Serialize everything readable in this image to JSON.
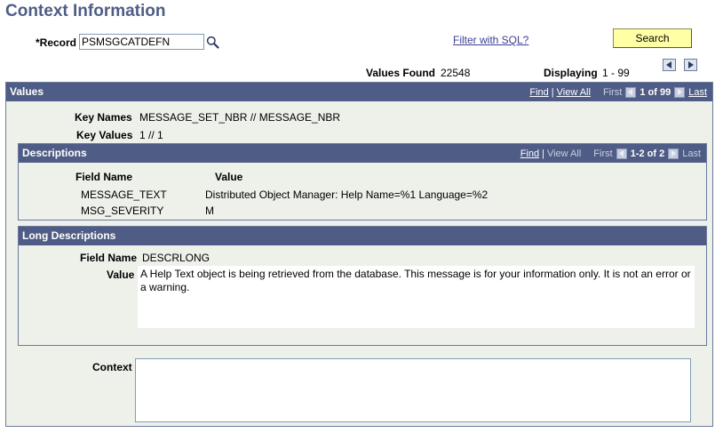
{
  "page": {
    "title": "Context Information"
  },
  "record": {
    "label": "*Record",
    "value": "PSMSGCATDEFN",
    "lookup_icon": "magnifier-icon"
  },
  "toolbar": {
    "filter_link": "Filter with SQL?",
    "search_label": "Search"
  },
  "results": {
    "values_found_label": "Values Found",
    "values_found": "22548",
    "displaying_label": "Displaying",
    "displaying_range": "1 - 99",
    "prev_icon": "triangle-left-icon",
    "next_icon": "triangle-right-icon"
  },
  "values_panel": {
    "title": "Values",
    "nav": {
      "find": "Find",
      "view_all": "View All",
      "first": "First",
      "counter": "1 of 99",
      "last": "Last"
    },
    "key_names_label": "Key Names",
    "key_names": "MESSAGE_SET_NBR // MESSAGE_NBR",
    "key_values_label": "Key Values",
    "key_values": "1 // 1"
  },
  "descriptions_panel": {
    "title": "Descriptions",
    "nav": {
      "find": "Find",
      "view_all": "View All",
      "first": "First",
      "counter": "1-2 of 2",
      "last": "Last"
    },
    "columns": [
      "Field Name",
      "Value"
    ],
    "rows": [
      {
        "field": "MESSAGE_TEXT",
        "value": "Distributed Object Manager: Help Name=%1 Language=%2"
      },
      {
        "field": "MSG_SEVERITY",
        "value": "M"
      }
    ]
  },
  "long_descriptions_panel": {
    "title": "Long Descriptions",
    "field_name_label": "Field Name",
    "field_name": "DESCRLONG",
    "value_label": "Value",
    "value": "A Help Text object is being retrieved from the database. This message is for your information only. It is not an error or a warning."
  },
  "context": {
    "label": "Context",
    "value": ""
  },
  "colors": {
    "header_bg": "#4f5d86",
    "panel_bg": "#eef0ea",
    "search_button_bg": "#ffffa6",
    "link": "#3b3e95"
  }
}
